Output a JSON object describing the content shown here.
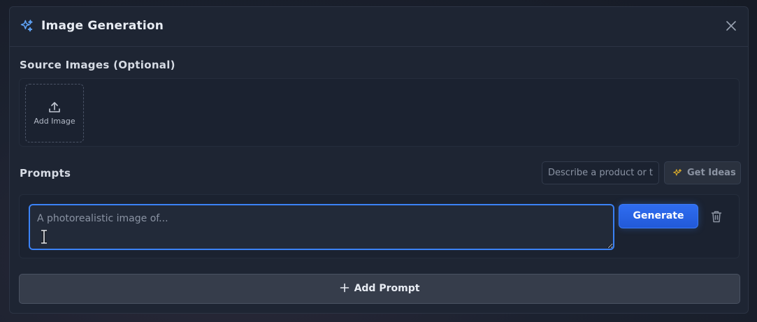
{
  "modal": {
    "title": "Image Generation",
    "title_icon": "sparkles-icon",
    "close_icon": "close-icon"
  },
  "source_images": {
    "title": "Source Images (Optional)",
    "add_image_label": "Add Image",
    "add_image_icon": "upload-icon"
  },
  "prompts": {
    "title": "Prompts",
    "ideas_input_placeholder": "Describe a product or theme",
    "ideas_input_value": "",
    "get_ideas_label": "Get Ideas",
    "get_ideas_icon": "sparkles-icon",
    "items": [
      {
        "placeholder": "A photorealistic image of...",
        "value": "",
        "generate_label": "Generate",
        "delete_icon": "trash-icon"
      }
    ],
    "add_prompt_label": "Add Prompt",
    "add_prompt_icon": "plus-icon"
  },
  "colors": {
    "accent": "#3b82f6",
    "background": "#1e2533",
    "ideas_icon": "#d4a72c"
  }
}
